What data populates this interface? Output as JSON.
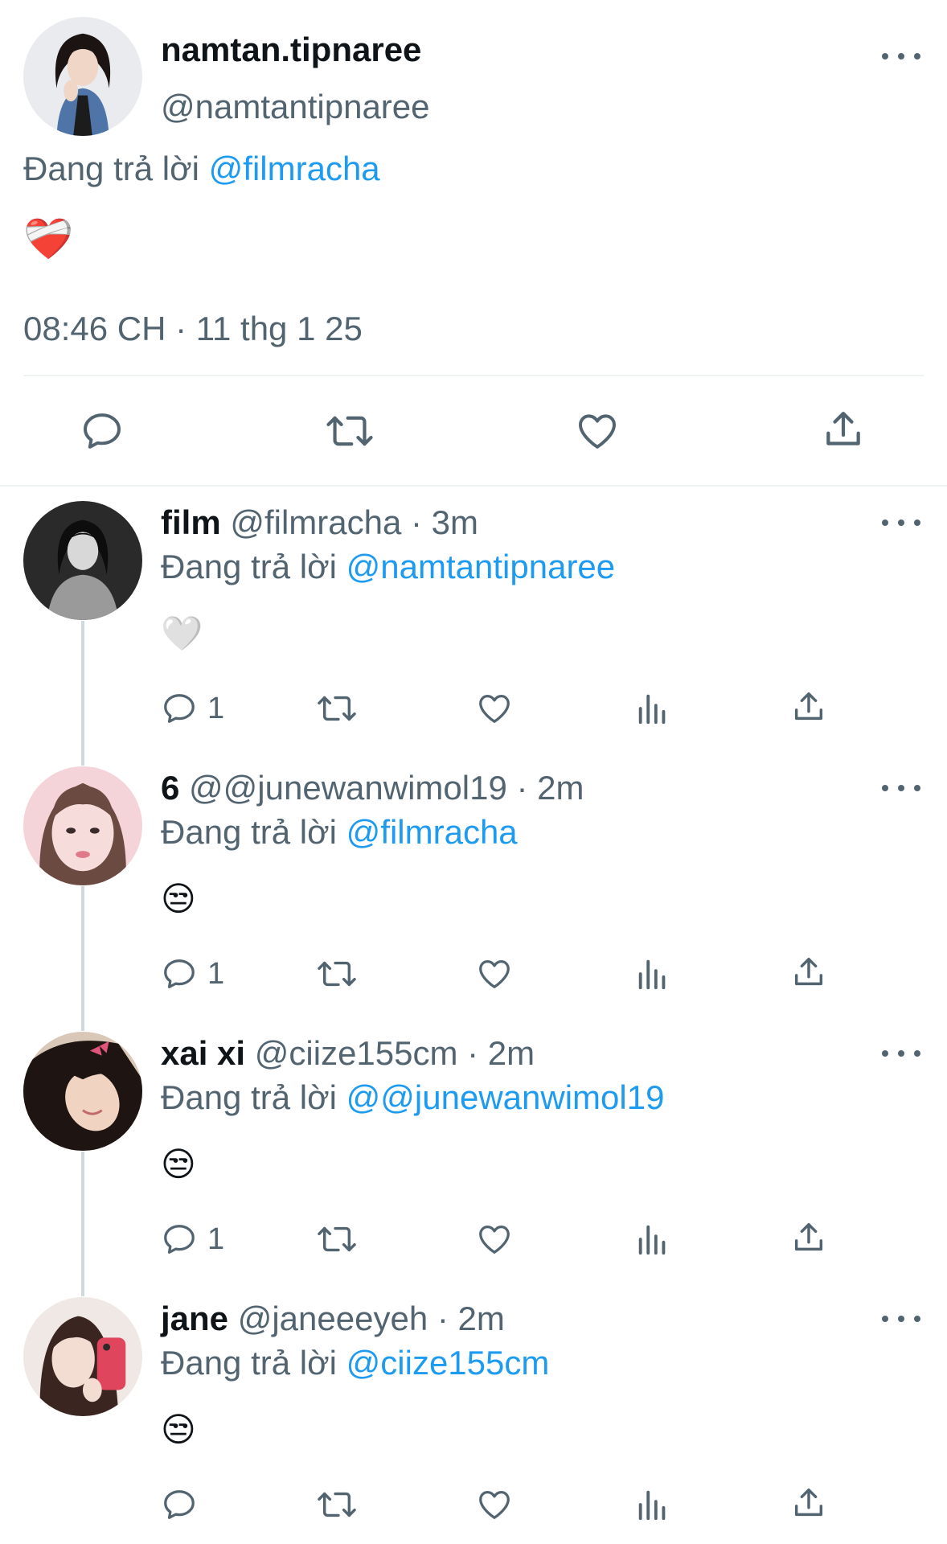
{
  "main_tweet": {
    "display_name": "namtan.tipnaree",
    "handle": "@namtantipnaree",
    "reply_prefix": "Đang trả lời",
    "reply_to": "@filmracha",
    "content_emoji": "❤️‍🩹",
    "timestamp": "08:46 CH · 11 thg 1 25"
  },
  "replies": [
    {
      "display_name": "film",
      "handle": "@filmracha",
      "time": "· 3m",
      "reply_prefix": "Đang trả lời",
      "reply_to": "@namtantipnaree",
      "content_emoji": "🤍",
      "reply_count": "1"
    },
    {
      "display_name": "6",
      "handle": "@@junewanwimol19",
      "time": "· 2m",
      "reply_prefix": "Đang trả lời",
      "reply_to": "@filmracha",
      "content_emoji": "😒",
      "reply_count": "1"
    },
    {
      "display_name": "xai xi",
      "handle": "@ciize155cm",
      "time": "· 2m",
      "reply_prefix": "Đang trả lời",
      "reply_to": "@@junewanwimol19",
      "content_emoji": "😒",
      "reply_count": "1"
    },
    {
      "display_name": "jane",
      "handle": "@janeeeyeh",
      "time": "· 2m",
      "reply_prefix": "Đang trả lời",
      "reply_to": "@ciize155cm",
      "content_emoji": "😒",
      "reply_count": ""
    }
  ],
  "icons": {
    "reply": "reply-icon",
    "retweet": "retweet-icon",
    "like": "heart-icon",
    "views": "views-icon",
    "share": "share-icon",
    "more": "more-icon"
  },
  "colors": {
    "link": "#1d9bf0",
    "secondary_text": "#536471",
    "primary_text": "#0f1419",
    "divider": "#eff3f4"
  }
}
